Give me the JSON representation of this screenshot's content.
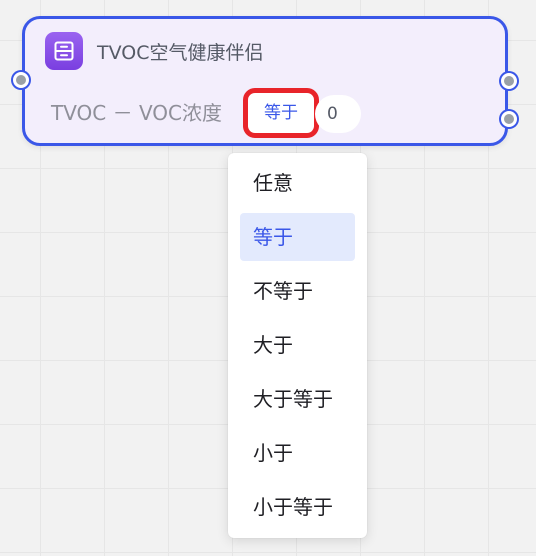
{
  "node": {
    "icon": "storage-drawer-icon",
    "title": "TVOC空气健康伴侣",
    "condition_label": "TVOC － VOC浓度",
    "operator_value": "等于",
    "value": "0"
  },
  "dropdown": {
    "items": [
      {
        "label": "任意"
      },
      {
        "label": "等于"
      },
      {
        "label": "不等于"
      },
      {
        "label": "大于"
      },
      {
        "label": "大于等于"
      },
      {
        "label": "小于"
      },
      {
        "label": "小于等于"
      }
    ],
    "selected_index": 1
  },
  "colors": {
    "accent": "#3a57e8",
    "highlight_border": "#e8242a",
    "node_bg": "#f3eefc",
    "icon_gradient_top": "#9a63f0",
    "icon_gradient_bottom": "#7a3fe0",
    "selected_bg": "#e3eafd"
  }
}
